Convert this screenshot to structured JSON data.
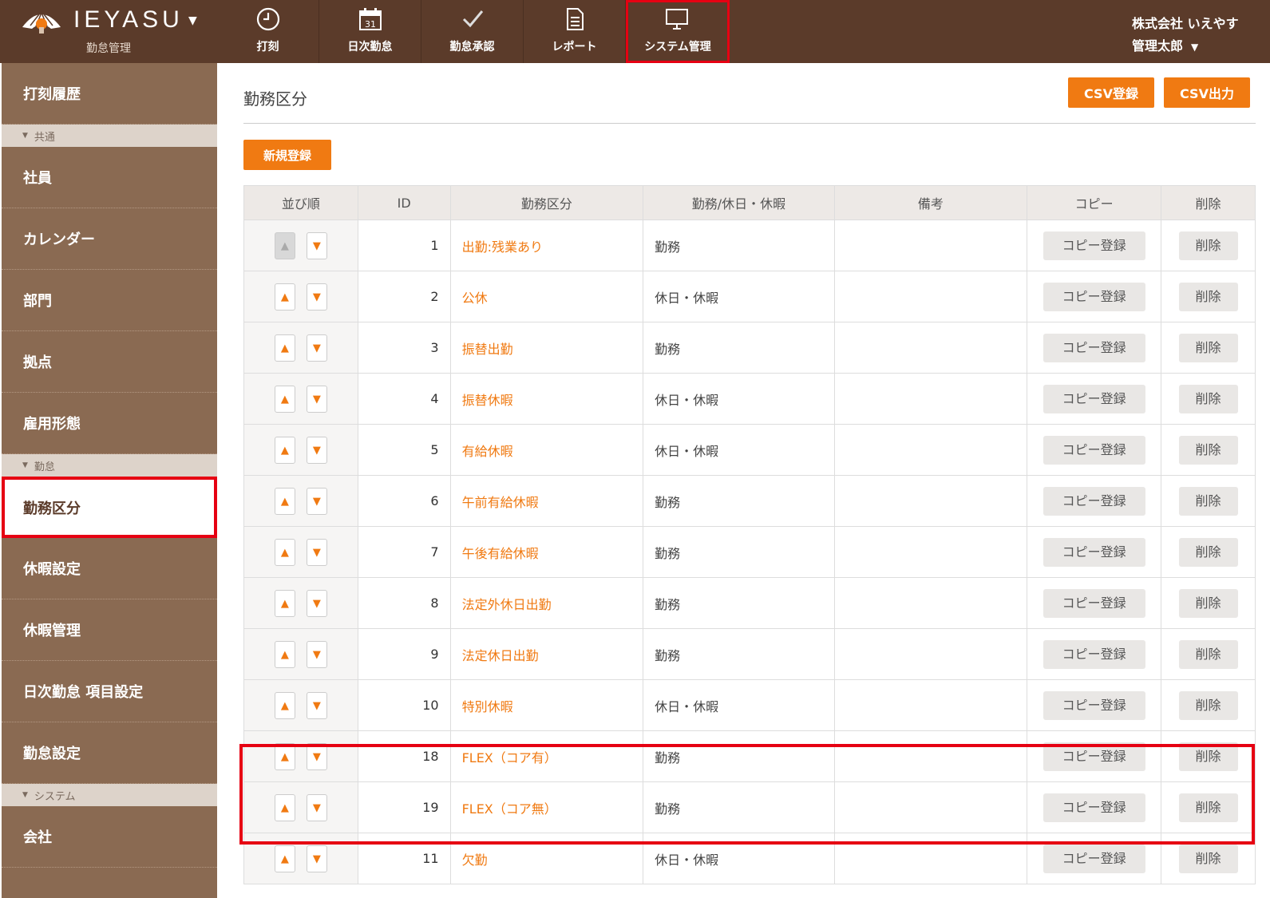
{
  "header": {
    "brand_name": "IEYASU",
    "brand_sub": "勤怠管理",
    "nav": [
      {
        "label": "打刻",
        "icon": "clock-icon"
      },
      {
        "label": "日次勤怠",
        "icon": "calendar-icon"
      },
      {
        "label": "勤怠承認",
        "icon": "checkmark-icon"
      },
      {
        "label": "レポート",
        "icon": "document-icon"
      },
      {
        "label": "システム管理",
        "icon": "monitor-icon",
        "active": true
      }
    ],
    "company": "株式会社 いえやす",
    "user_name": "管理太郎"
  },
  "sidebar": {
    "top_item": "打刻履歴",
    "sections": [
      {
        "title": "共通",
        "items": [
          "社員",
          "カレンダー",
          "部門",
          "拠点",
          "雇用形態"
        ]
      },
      {
        "title": "勤怠",
        "items": [
          "勤務区分",
          "休暇設定",
          "休暇管理",
          "日次勤怠 項目設定",
          "勤怠設定"
        ]
      },
      {
        "title": "システム",
        "items": [
          "会社"
        ]
      }
    ],
    "active_item": "勤務区分"
  },
  "main": {
    "title": "勤務区分",
    "csv_import_label": "CSV登録",
    "csv_export_label": "CSV出力",
    "new_label": "新規登録"
  },
  "table": {
    "headers": [
      "並び順",
      "ID",
      "勤務区分",
      "勤務/休日・休暇",
      "備考",
      "コピー",
      "削除"
    ],
    "copy_label": "コピー登録",
    "delete_label": "削除",
    "rows": [
      {
        "id": "1",
        "name": "出勤:残業あり",
        "type": "勤務",
        "note": ""
      },
      {
        "id": "2",
        "name": "公休",
        "type": "休日・休暇",
        "note": ""
      },
      {
        "id": "3",
        "name": "振替出勤",
        "type": "勤務",
        "note": ""
      },
      {
        "id": "4",
        "name": "振替休暇",
        "type": "休日・休暇",
        "note": ""
      },
      {
        "id": "5",
        "name": "有給休暇",
        "type": "休日・休暇",
        "note": ""
      },
      {
        "id": "6",
        "name": "午前有給休暇",
        "type": "勤務",
        "note": ""
      },
      {
        "id": "7",
        "name": "午後有給休暇",
        "type": "勤務",
        "note": ""
      },
      {
        "id": "8",
        "name": "法定外休日出勤",
        "type": "勤務",
        "note": ""
      },
      {
        "id": "9",
        "name": "法定休日出勤",
        "type": "勤務",
        "note": ""
      },
      {
        "id": "10",
        "name": "特別休暇",
        "type": "休日・休暇",
        "note": ""
      },
      {
        "id": "18",
        "name": "FLEX（コア有）",
        "type": "勤務",
        "note": ""
      },
      {
        "id": "19",
        "name": "FLEX（コア無）",
        "type": "勤務",
        "note": ""
      },
      {
        "id": "11",
        "name": "欠勤",
        "type": "休日・休暇",
        "note": ""
      }
    ]
  },
  "colors": {
    "header_bg": "#5b3b2a",
    "sidebar_bg": "#8a6a52",
    "accent_orange": "#f07a12",
    "highlight_red": "#e60012"
  }
}
